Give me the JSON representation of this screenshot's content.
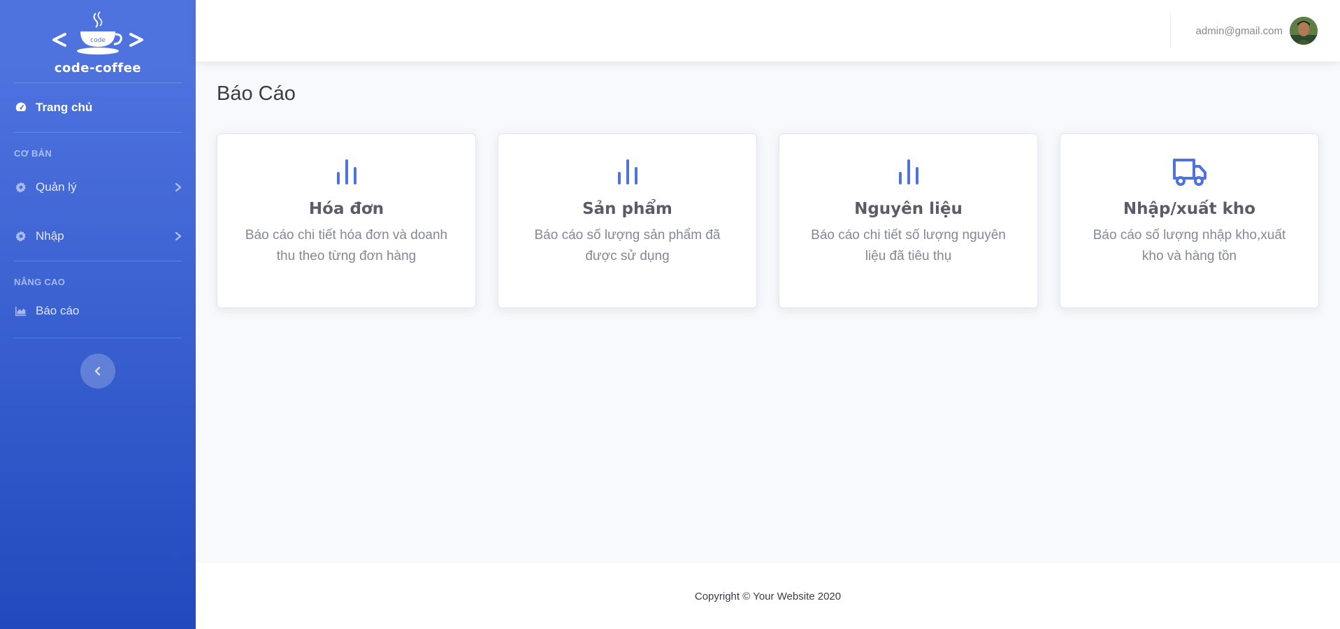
{
  "brand": {
    "name": "code-coffee",
    "logo_text": "code"
  },
  "sidebar": {
    "dashboard": {
      "label": "Trang chủ",
      "icon": "tachometer-icon"
    },
    "section_basic": "CƠ BẢN",
    "items_basic": [
      {
        "label": "Quản lý",
        "icon": "gear-icon"
      },
      {
        "label": "Nhập",
        "icon": "gear-icon"
      }
    ],
    "section_advanced": "NÂNG CAO",
    "report": {
      "label": "Báo cáo",
      "icon": "area-chart-icon"
    }
  },
  "topbar": {
    "user_email": "admin@gmail.com"
  },
  "page": {
    "title": "Báo Cáo"
  },
  "cards": [
    {
      "title": "Hóa đơn",
      "description": "Báo cáo chi tiết hóa đơn và doanh thu theo từng đơn hàng",
      "icon": "bar-chart-icon"
    },
    {
      "title": "Sản phẩm",
      "description": "Báo cáo số lượng sản phẩm đã được sử dụng",
      "icon": "bar-chart-icon"
    },
    {
      "title": "Nguyên liệu",
      "description": "Báo cáo chi tiết số lượng nguyên liệu đã tiêu thụ",
      "icon": "bar-chart-icon"
    },
    {
      "title": "Nhập/xuất kho",
      "description": "Báo cáo số lượng nhập kho,xuất kho và hàng tồn",
      "icon": "truck-icon"
    }
  ],
  "footer": {
    "copyright": "Copyright © Your Website 2020"
  },
  "colors": {
    "primary": "#4e73df",
    "sidebar_bottom": "#224abe",
    "text_muted": "#858796"
  }
}
